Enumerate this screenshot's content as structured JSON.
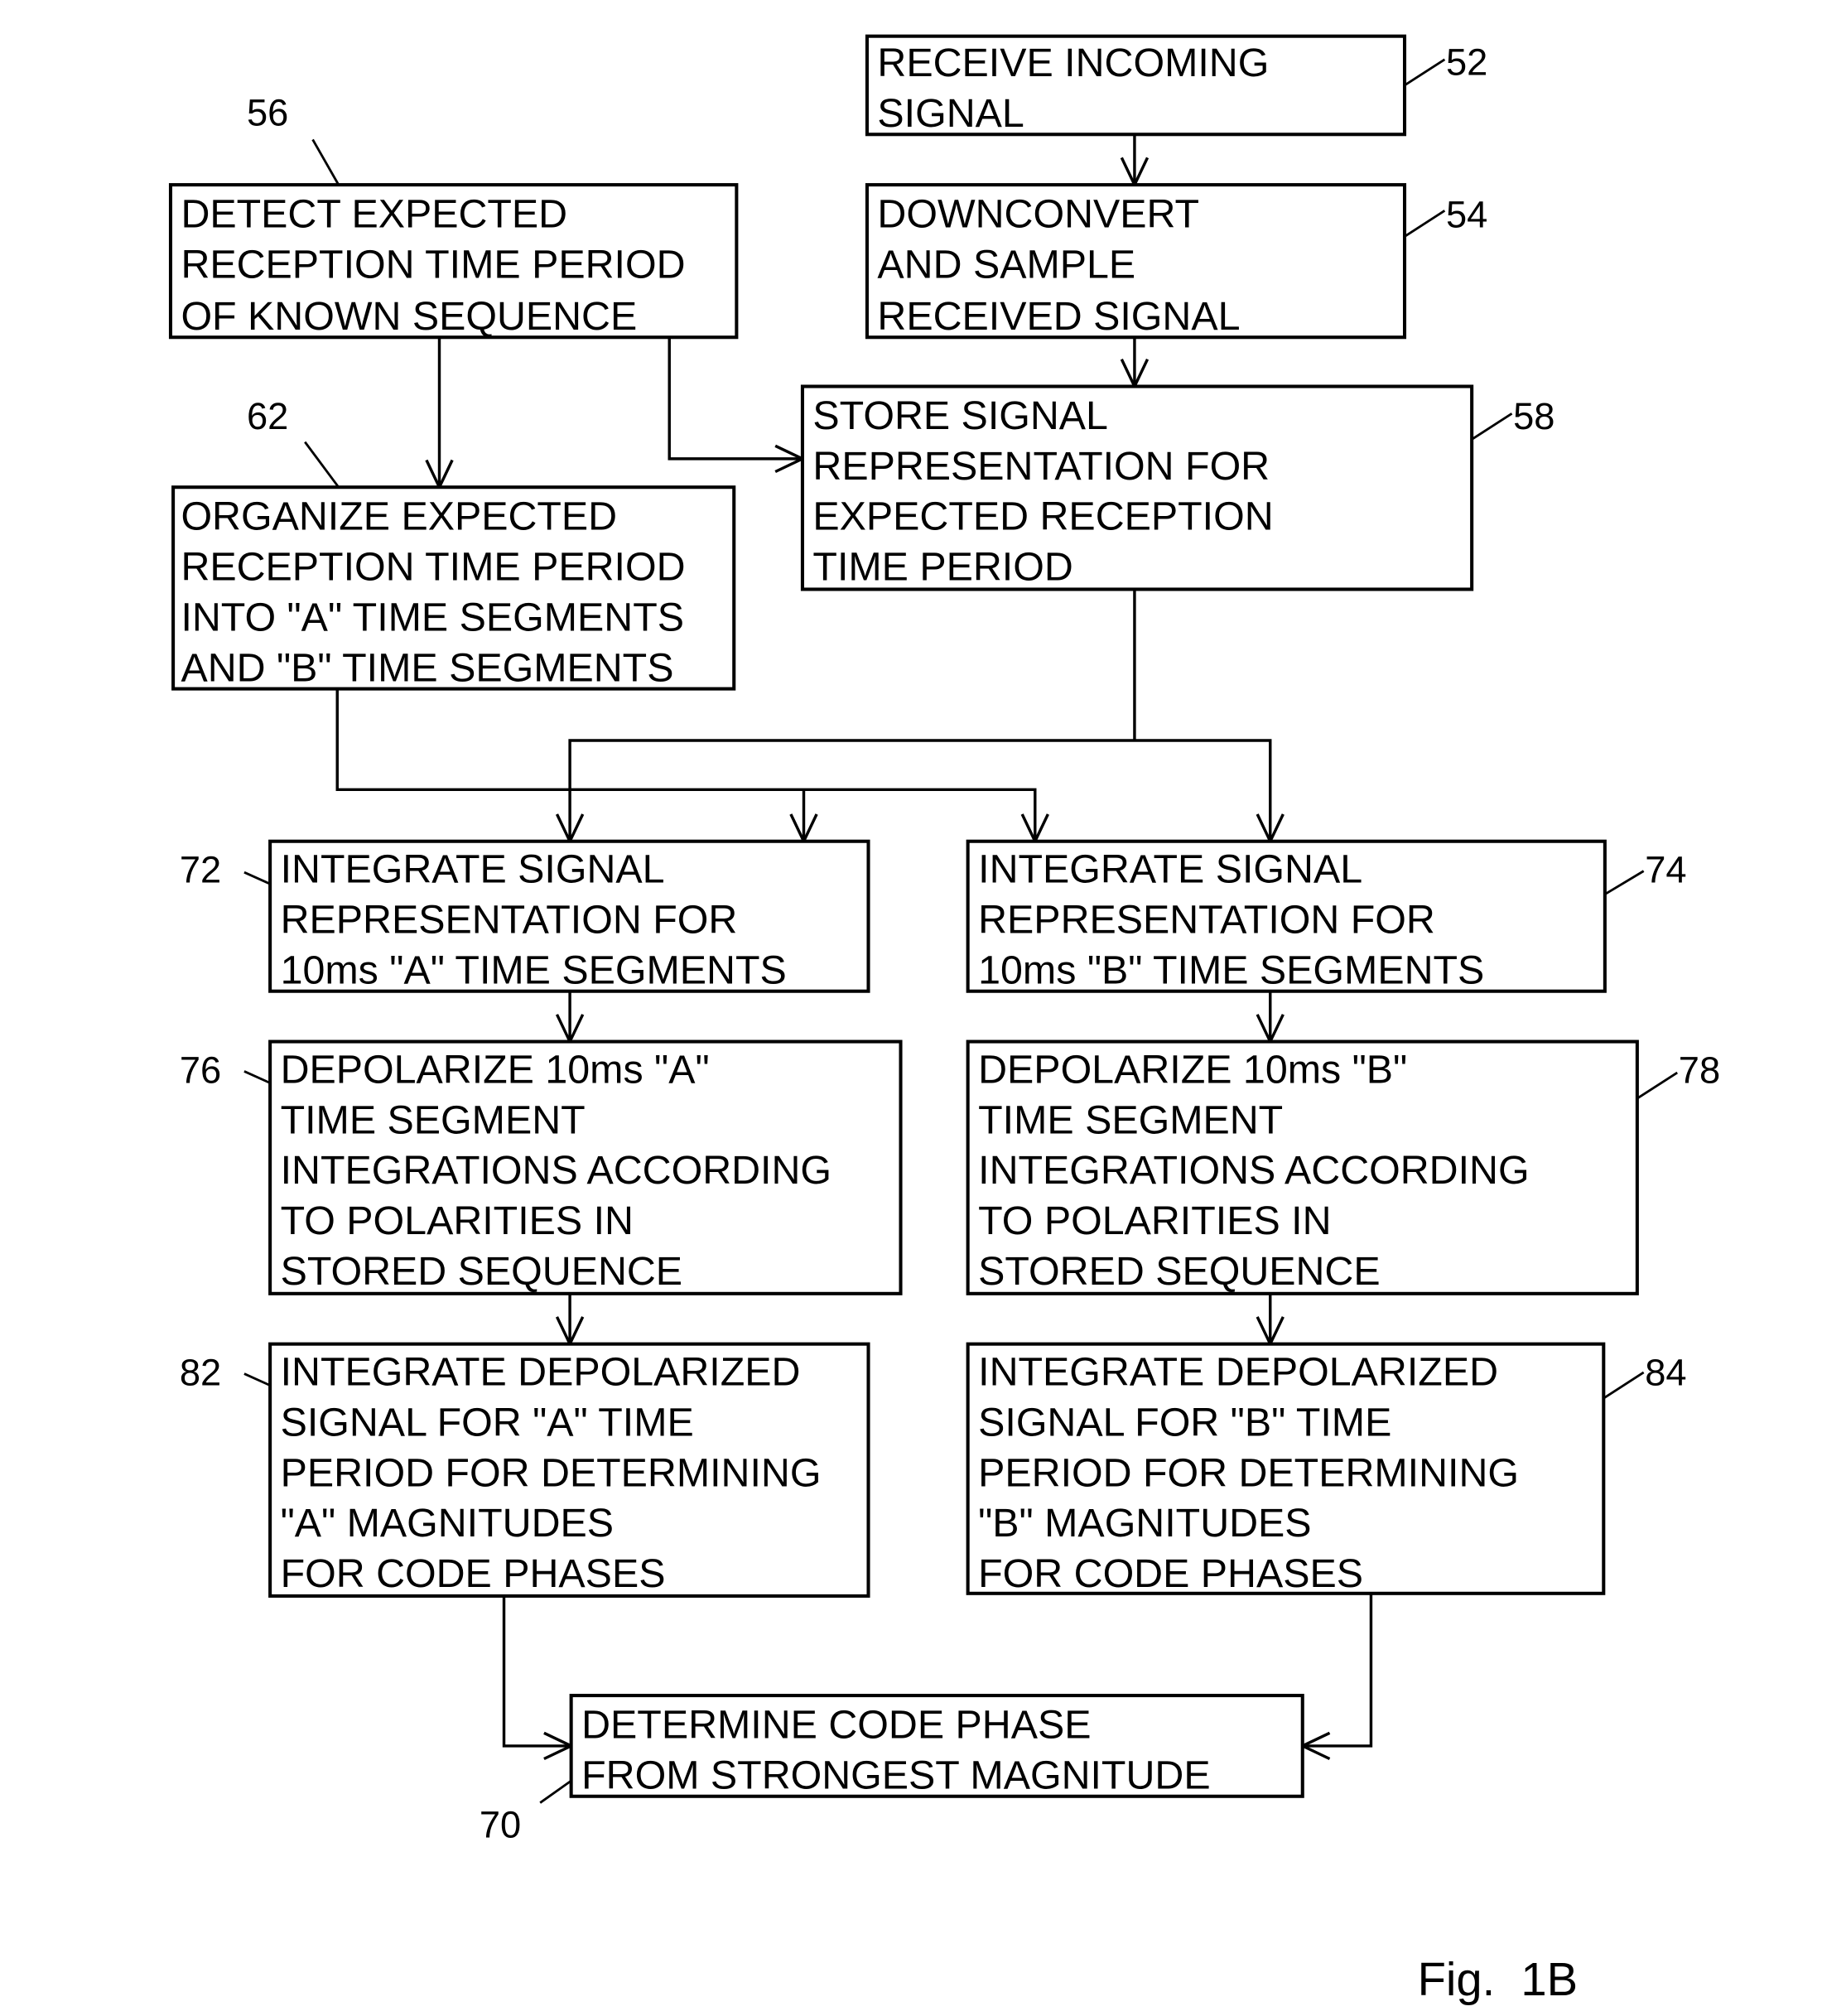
{
  "figure": {
    "label": "Fig.  1B",
    "boxes": {
      "b52": {
        "ref": "52",
        "lines": [
          "RECEIVE INCOMING",
          "SIGNAL"
        ]
      },
      "b54": {
        "ref": "54",
        "lines": [
          "DOWNCONVERT",
          "AND SAMPLE",
          "RECEIVED SIGNAL"
        ]
      },
      "b56": {
        "ref": "56",
        "lines": [
          "DETECT EXPECTED",
          "RECEPTION TIME PERIOD",
          "OF KNOWN SEQUENCE"
        ]
      },
      "b58": {
        "ref": "58",
        "lines": [
          "STORE SIGNAL",
          "REPRESENTATION FOR",
          "EXPECTED RECEPTION",
          "TIME PERIOD"
        ]
      },
      "b62": {
        "ref": "62",
        "lines": [
          "ORGANIZE EXPECTED",
          "RECEPTION TIME PERIOD",
          "INTO \"A\" TIME SEGMENTS",
          "AND \"B\" TIME SEGMENTS"
        ]
      },
      "b72": {
        "ref": "72",
        "lines": [
          "INTEGRATE SIGNAL",
          "REPRESENTATION FOR",
          "10ms \"A\" TIME SEGMENTS"
        ]
      },
      "b74": {
        "ref": "74",
        "lines": [
          "INTEGRATE SIGNAL",
          "REPRESENTATION FOR",
          "10ms \"B\" TIME SEGMENTS"
        ]
      },
      "b76": {
        "ref": "76",
        "lines": [
          "DEPOLARIZE 10ms \"A\"",
          "TIME SEGMENT",
          "INTEGRATIONS ACCORDING",
          "TO POLARITIES IN",
          "STORED SEQUENCE"
        ]
      },
      "b78": {
        "ref": "78",
        "lines": [
          "DEPOLARIZE 10ms \"B\"",
          "TIME SEGMENT",
          "INTEGRATIONS ACCORDING",
          "TO POLARITIES IN",
          "STORED SEQUENCE"
        ]
      },
      "b82": {
        "ref": "82",
        "lines": [
          "INTEGRATE DEPOLARIZED",
          "SIGNAL FOR \"A\" TIME",
          "PERIOD  FOR DETERMINING",
          "\"A\" MAGNITUDES",
          "FOR CODE PHASES"
        ]
      },
      "b84": {
        "ref": "84",
        "lines": [
          "INTEGRATE DEPOLARIZED",
          "SIGNAL FOR \"B\" TIME",
          "PERIOD  FOR DETERMINING",
          "\"B\" MAGNITUDES",
          "FOR CODE PHASES"
        ]
      },
      "b70": {
        "ref": "70",
        "lines": [
          "DETERMINE CODE PHASE",
          "FROM STRONGEST MAGNITUDE"
        ]
      }
    }
  }
}
